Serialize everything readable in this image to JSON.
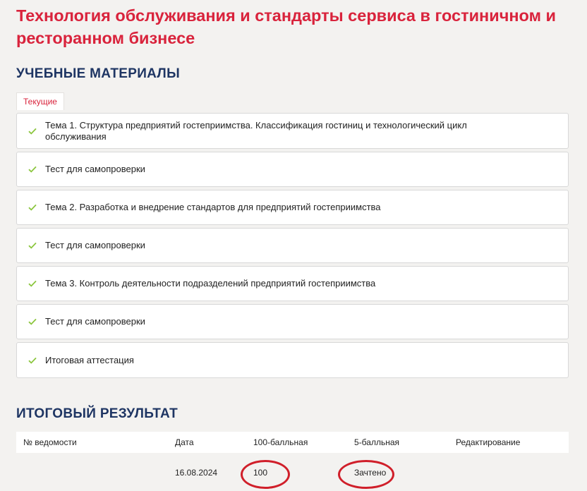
{
  "course": {
    "title": "Технология обслуживания и стандарты сервиса в гостиничном и ресторанном бизнесе"
  },
  "materials": {
    "heading": "Учебные материалы",
    "tabs": [
      {
        "label": "Текущие",
        "active": true
      }
    ],
    "items": [
      {
        "label": "Тема 1. Структура предприятий гостеприимства. Классификация гостиниц и технологический цикл обслуживания",
        "completed": true
      },
      {
        "label": "Тест для самопроверки",
        "completed": true
      },
      {
        "label": "Тема 2. Разработка и внедрение стандартов для предприятий гостеприимства",
        "completed": true
      },
      {
        "label": "Тест для самопроверки",
        "completed": true
      },
      {
        "label": "Тема 3. Контроль деятельности подразделений предприятий гостеприимства",
        "completed": true
      },
      {
        "label": "Тест для самопроверки",
        "completed": true
      },
      {
        "label": "Итоговая аттестация",
        "completed": true
      }
    ]
  },
  "result": {
    "heading": "Итоговый результат",
    "columns": [
      "№ ведомости",
      "Дата",
      "100-балльная",
      "5-балльная",
      "Редактирование"
    ],
    "rows": [
      {
        "statement_no": "",
        "date": "16.08.2024",
        "score_100": "100",
        "score_5": "Зачтено",
        "edit": ""
      }
    ]
  },
  "colors": {
    "title_red": "#d9233c",
    "heading_navy": "#1e3563",
    "check_green": "#8cc63f",
    "annotation_red": "#d01f2a",
    "background": "#f3f2f0"
  }
}
